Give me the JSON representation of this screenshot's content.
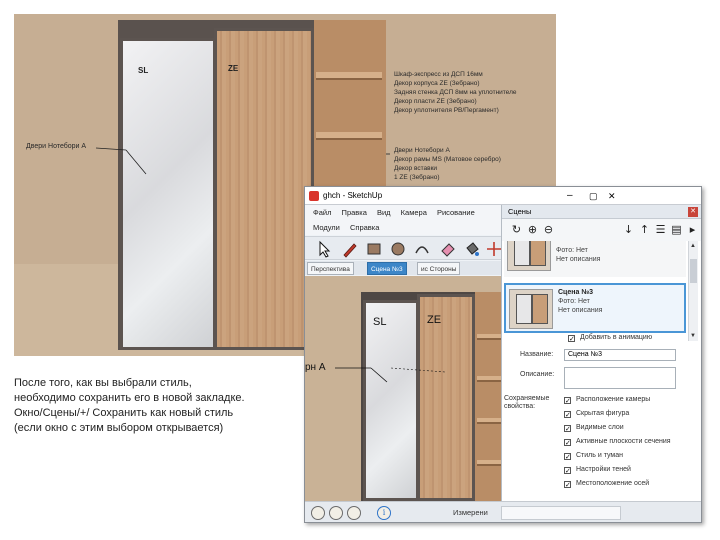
{
  "render": {
    "label_sl": "SL",
    "label_ze": "ZE",
    "door_label": "Двери Нотебори А",
    "notes_top": [
      "Шкаф-экспресс из ДСП 16мм",
      "Декор корпуса ZE (Зебрано)",
      "Задняя стенка ДСП 8мм на уплотнителе",
      "Декор пласти ZE (Зебрано)",
      "Декор уплотнителя PB/Пергамент)"
    ],
    "notes_bottom": [
      "Двери Нотебори А",
      "Декор рамы MS (Матовое серебро)",
      "Декор вставки",
      "1 ZE (Зебрано)"
    ]
  },
  "window": {
    "title": "ghch - SketchUp",
    "menu_row1": [
      "Файл",
      "Правка",
      "Вид",
      "Камера",
      "Рисование"
    ],
    "menu_row2": [
      "Модули",
      "Справка"
    ],
    "tabs": [
      "Перспектива",
      "Сцена №3",
      "ис Стороны"
    ],
    "active_tab_index": 1,
    "viewport_label_sl": "SL",
    "viewport_label_ze": "ZE",
    "viewport_door_label": "рн А",
    "status_text": "Измерени",
    "status_circle_i": "i"
  },
  "tray": {
    "title": "Сцены",
    "scenes": [
      {
        "photo_line": "Фото: Нет",
        "desc_line": "Нет описания"
      },
      {
        "name": "Сцена №3",
        "photo_line": "Фото: Нет",
        "desc_line": "Нет описания"
      }
    ],
    "include_label": "Добавить в анимацию",
    "name_label": "Название:",
    "name_value": "Сцена №3",
    "desc_label": "Описание:",
    "save_label_line1": "Сохраняемые",
    "save_label_line2": "свойства:",
    "properties": [
      "Расположение камеры",
      "Скрытая фигура",
      "Видимые слои",
      "Активные плоскости сечения",
      "Стиль и туман",
      "Настройки теней",
      "Местоположение осей"
    ]
  },
  "caption": [
    "После того, как вы выбрали стиль,",
    "необходимо сохранить его в новой закладке.",
    "Окно/Сцены/+/ Сохранить как новый стиль",
    "(если окно с этим выбором открывается)"
  ]
}
